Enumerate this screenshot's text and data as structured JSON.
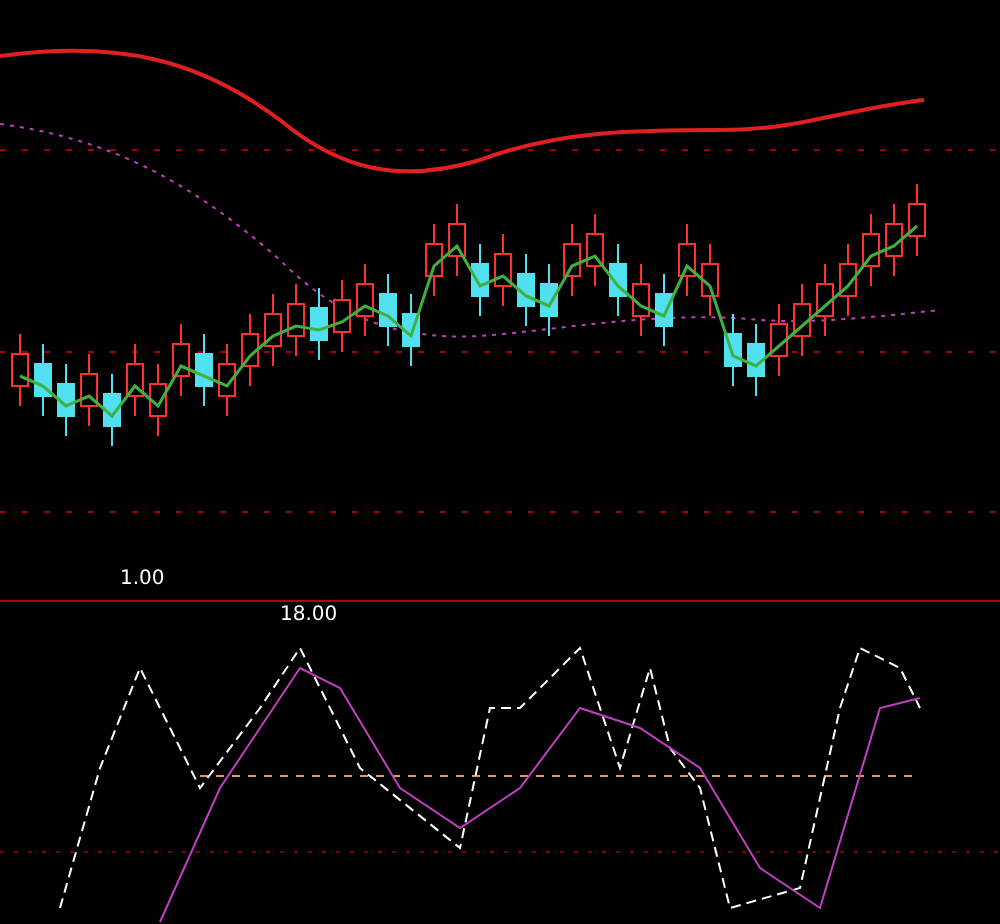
{
  "middle_legend": [
    {
      "text": "1.00",
      "color": "#ffffff"
    }
  ],
  "bottom_legend": [
    {
      "text": "18.00",
      "color": "#ffffff"
    }
  ]
}
